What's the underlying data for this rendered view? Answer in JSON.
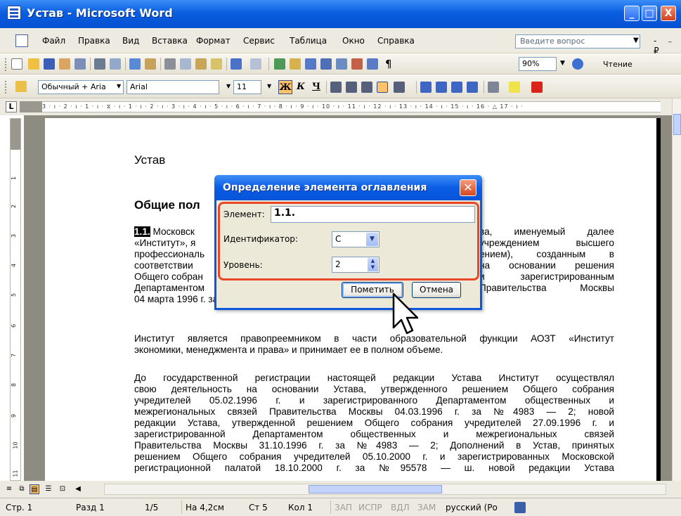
{
  "window": {
    "title": "Устав - Microsoft Word",
    "min_label": "_",
    "max_label": "□",
    "close_label": "X"
  },
  "menu": {
    "items": [
      "Файл",
      "Правка",
      "Вид",
      "Вставка",
      "Формат",
      "Сервис",
      "Таблица",
      "Окно",
      "Справка"
    ],
    "help_placeholder": "Введите вопрос",
    "window_controls": "- ₋ ₽ ×"
  },
  "toolbar": {
    "zoom": "90%",
    "read_label": "Чтение",
    "paragraph_mark": "¶",
    "style": "Обычный + Aria",
    "font": "Arial",
    "size": "11",
    "bold": "Ж",
    "italic": "К",
    "underline": "Ч"
  },
  "ruler": {
    "corner": "L",
    "text": "3 · ı · 2 · ı · 1 · ı · ⧖ · ı · 1 · ı · 2 · ı · 3 · ı · 4 · ı · 5 · ı · 6 · ı · 7 · ı · 8 · ı · 9 · ı · 10 · ı · 11 · ı · 12 · ı · 13 · ı · 14 · ı · 15 · ı · 16 · △ 17 · ı ·",
    "vticks": [
      "1",
      "1",
      "2",
      "3",
      "4",
      "5",
      "6",
      "7",
      "8",
      "9",
      "10",
      "11"
    ]
  },
  "document": {
    "heading": "Устав",
    "subheading": "Общие пол",
    "marker": "1.1.",
    "para1": [
      " Московск",
      "«Институт», я",
      "профессиональ",
      "соответствии",
      "Общего собран",
      "Департаментом",
      "04 марта 1996 г. за №4983-2."
    ],
    "para1_right": [
      "ва, именуемый далее",
      "учреждением высшего",
      "ением), созданным в",
      "на основании решения",
      "и зарегистрированным",
      "Правительства Москвы"
    ],
    "para2": [
      "Институт является правопреемником в части образовательной функции АОЗТ «Институт",
      "экономики, менеджмента и права» и принимает ее в полном объеме."
    ],
    "para3": [
      "До государственной регистрации настоящей редакции Устава Институт осуществлял",
      "свою деятельность на основании Устава, утвержденного решением Общего собрания",
      "учредителей 05.02.1996 г. и зарегистрированного Департаментом общественных и",
      "межрегиональных связей Правительства Москвы 04.03.1996 г. за №4983 — 2; новой",
      "редакции Устава, утвержденной решением Общего собрания учредителей 27.09.1996 г. и",
      "зарегистрированной Департаментом общественных и межрегиональных связей",
      "Правительства Москвы 31.10.1996 г. за №4983 — 2; Дополнений в Устав, принятых",
      "решением Общего собрания учредителей 05.10.2000 г. и зарегистрированных Московской",
      "регистрационной палатой 18.10.2000 г. за №95578 — ш. новой редакции Устава"
    ]
  },
  "dialog": {
    "title": "Определение элемента оглавления",
    "element_label": "Элемент:",
    "element_value": "1.1.",
    "id_label": "Идентификатор:",
    "id_value": "C",
    "level_label": "Уровень:",
    "level_value": "2",
    "mark_button": "Пометить",
    "cancel_button": "Отмена"
  },
  "status": {
    "page": "Стр. 1",
    "section": "Разд 1",
    "pages": "1/5",
    "at": "На 4,2см",
    "line": "Ст 5",
    "col": "Кол 1",
    "rec": "ЗАП",
    "trk": "ИСПР",
    "ext": "ВДЛ",
    "ovr": "ЗАМ",
    "language": "русский (Ро"
  }
}
